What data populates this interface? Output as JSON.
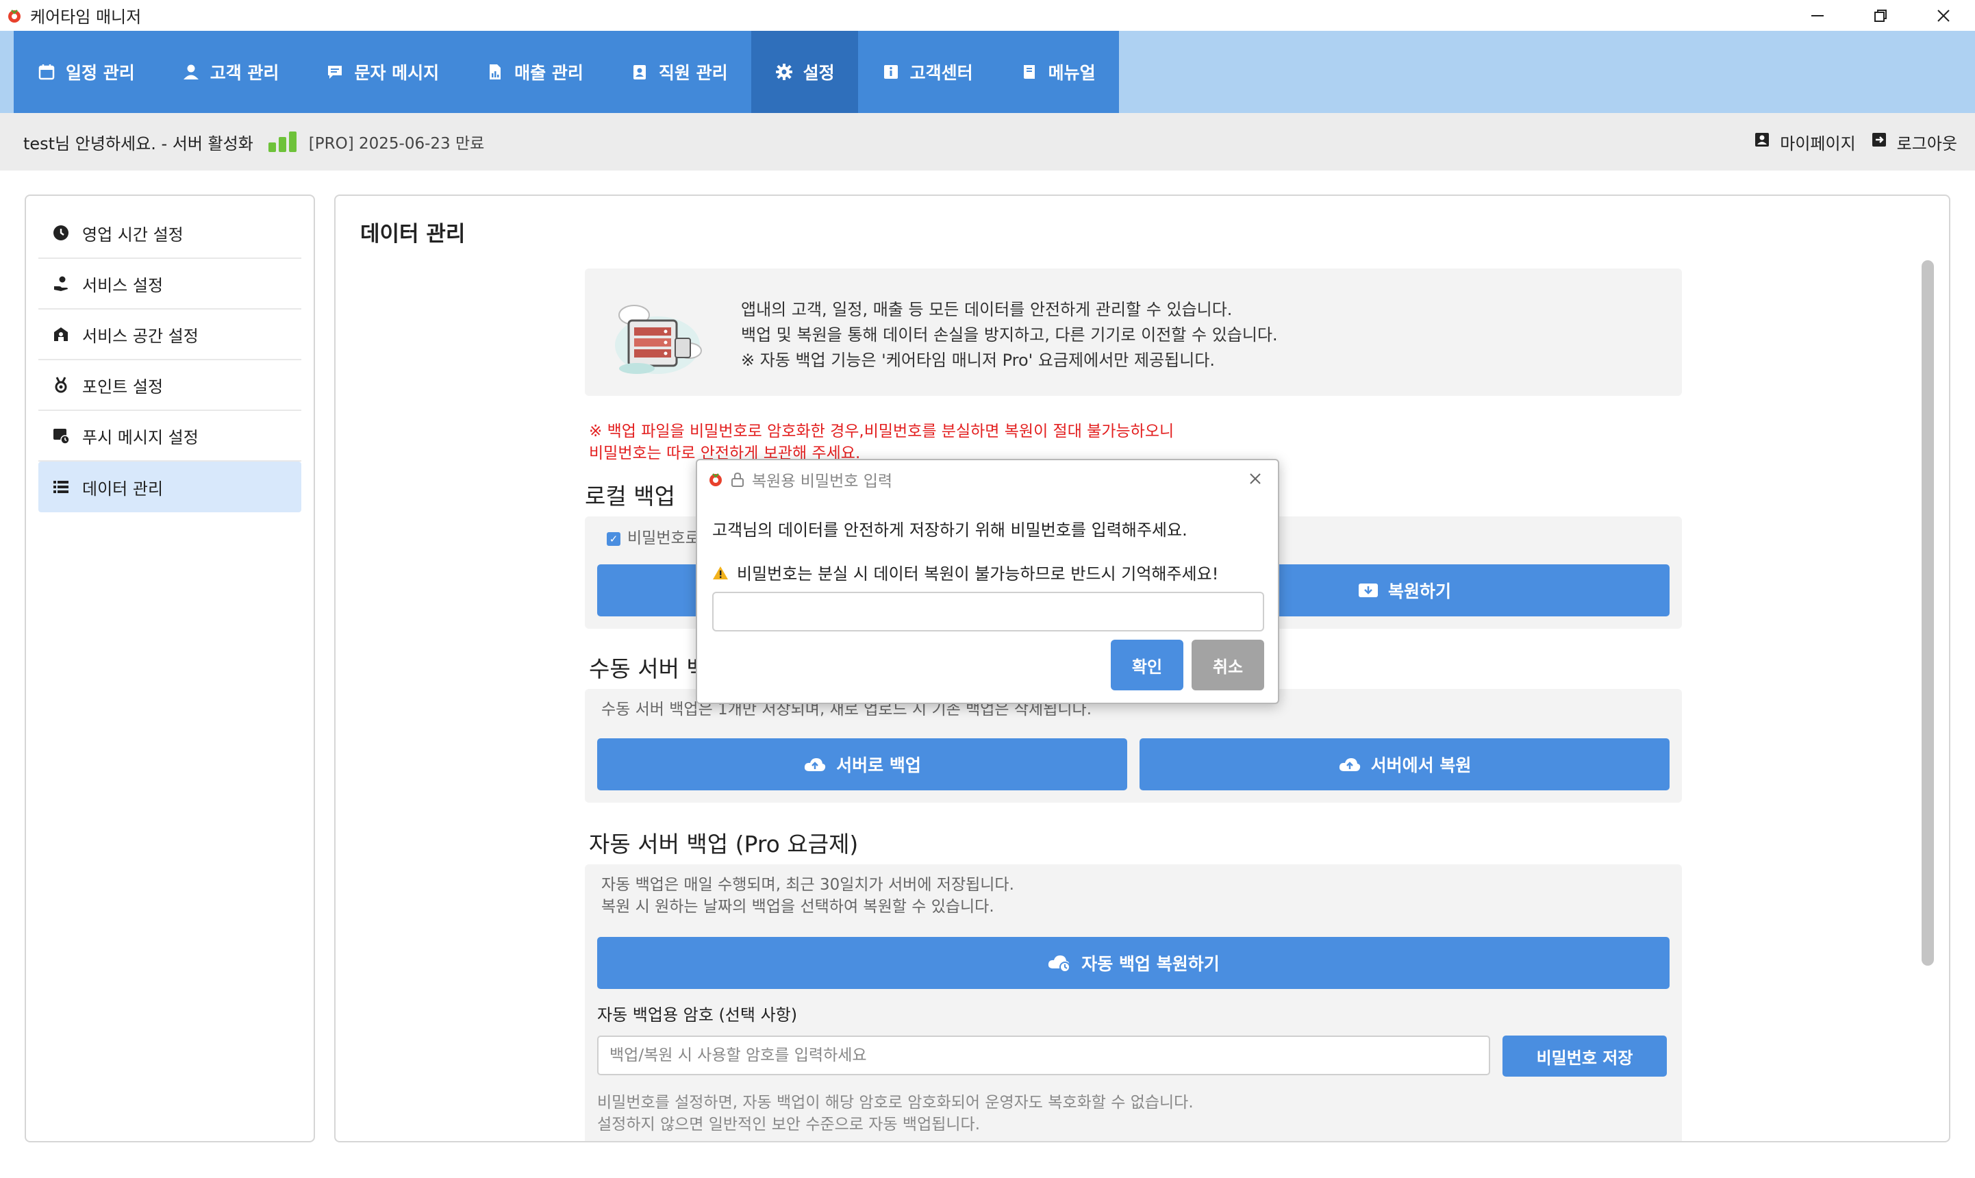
{
  "window": {
    "title": "케어타임 매니저",
    "minimize_glyph": "—",
    "restore_glyph": "❐",
    "close_glyph": "✕"
  },
  "nav": {
    "items": [
      {
        "label": "일정 관리",
        "icon": "calendar-icon"
      },
      {
        "label": "고객 관리",
        "icon": "user-icon"
      },
      {
        "label": "문자 메시지",
        "icon": "chat-icon"
      },
      {
        "label": "매출 관리",
        "icon": "document-chart-icon"
      },
      {
        "label": "직원 관리",
        "icon": "id-badge-icon"
      },
      {
        "label": "설정",
        "icon": "gear-icon"
      },
      {
        "label": "고객센터",
        "icon": "info-icon"
      },
      {
        "label": "메뉴얼",
        "icon": "book-icon"
      }
    ],
    "active_index": 5
  },
  "status": {
    "greeting": "test님 안녕하세요. - 서버 활성화",
    "plan": "[PRO] 2025-06-23 만료",
    "mypage": "마이페이지",
    "logout": "로그아웃",
    "signal_color": "#6ec23a"
  },
  "sidebar": {
    "items": [
      {
        "label": "영업 시간 설정",
        "icon": "clock-icon"
      },
      {
        "label": "서비스 설정",
        "icon": "hand-user-icon"
      },
      {
        "label": "서비스 공간 설정",
        "icon": "store-icon"
      },
      {
        "label": "포인트 설정",
        "icon": "medal-icon"
      },
      {
        "label": "푸시 메시지 설정",
        "icon": "push-message-icon"
      },
      {
        "label": "데이터 관리",
        "icon": "list-icon"
      }
    ],
    "active_index": 5
  },
  "main": {
    "title": "데이터 관리",
    "info": {
      "line1": "앱내의 고객, 일정, 매출 등 모든 데이터를 안전하게 관리할 수 있습니다.",
      "line2": "백업 및 복원을 통해 데이터 손실을 방지하고, 다른 기기로 이전할 수 있습니다.",
      "line3": "※ 자동 백업 기능은 '케어타임 매니저 Pro' 요금제에서만 제공됩니다."
    },
    "warning": {
      "line1": "※ 백업 파일을 비밀번호로 암호화한 경우,비밀번호를 분실하면 복원이 절대 불가능하오니",
      "line2": "비밀번호는 따로 안전하게 보관해 주세요."
    },
    "local": {
      "title": "로컬 백업",
      "checkbox_label": "비밀번호로",
      "restore_button": "복원하기"
    },
    "manual": {
      "title": "수동 서버 백업",
      "note": "수동 서버 백업은 1개만 저장되며, 새로 업로드 시 기존 백업은 삭제됩니다.",
      "backup_button": "서버로 백업",
      "restore_button": "서버에서 복원"
    },
    "auto": {
      "title": "자동 서버 백업 (Pro 요금제)",
      "note1": "자동 백업은 매일 수행되며, 최근 30일치가 서버에 저장됩니다.",
      "note2": "복원 시 원하는 날짜의 백업을 선택하여 복원할 수 있습니다.",
      "restore_button": "자동 백업 복원하기",
      "password_label": "자동 백업용 암호 (선택 사항)",
      "password_placeholder": "백업/복원 시 사용할 암호를 입력하세요",
      "save_button": "비밀번호 저장",
      "footer1": "비밀번호를 설정하면, 자동 백업이 해당 암호로 암호화되어 운영자도 복호화할 수 없습니다.",
      "footer2": "설정하지 않으면 일반적인 보안 수준으로 자동 백업됩니다."
    }
  },
  "modal": {
    "title": "복원용 비밀번호 입력",
    "message": "고객님의 데이터를 안전하게 저장하기 위해 비밀번호를 입력해주세요.",
    "warning": "비밀번호는 분실 시 데이터 복원이 불가능하므로 반드시 기억해주세요!",
    "ok": "확인",
    "cancel": "취소"
  },
  "colors": {
    "nav_bg": "#4289d9",
    "nav_active": "#2f6fbb",
    "nav_strip": "#aed1f2",
    "button_blue": "#4a8ee0",
    "warning_red": "#e32020",
    "sidebar_active": "#d8e8fb"
  }
}
